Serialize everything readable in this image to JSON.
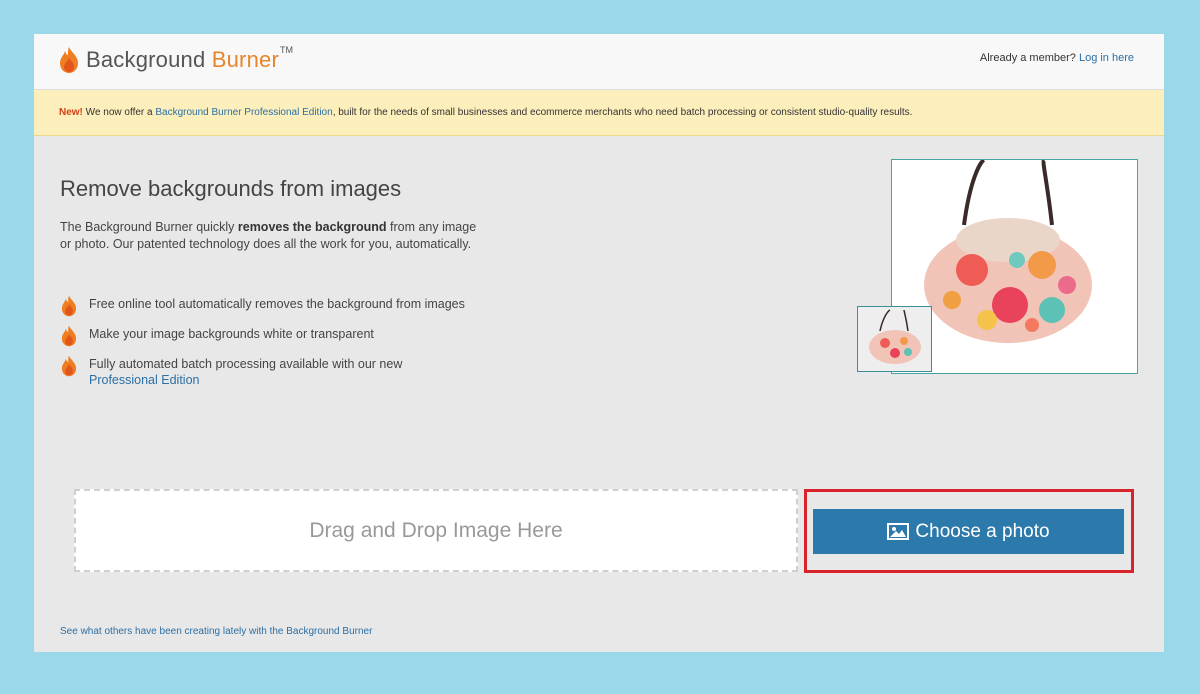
{
  "header": {
    "brand_part1": "Background ",
    "brand_part2": "Burner",
    "trademark": "TM",
    "member_text": "Already a member?",
    "login_link": "Log in here"
  },
  "banner": {
    "new_label": "New!",
    "text_before": " We now offer a ",
    "link": "Background Burner Professional Edition",
    "text_after": ", built for the needs of small businesses and ecommerce merchants who need batch processing or consistent studio-quality results."
  },
  "main": {
    "heading": "Remove backgrounds from images",
    "intro_before": "The Background Burner quickly ",
    "intro_bold": "removes the background",
    "intro_after": " from any image or photo. Our patented technology does all the work for you, automatically.",
    "features": [
      {
        "text": "Free online tool automatically removes the background from images"
      },
      {
        "text": "Make your image backgrounds white or transparent"
      },
      {
        "text": "Fully automated batch processing available with our new ",
        "link": "Professional Edition"
      }
    ]
  },
  "upload": {
    "dropzone_text": "Drag and Drop Image Here",
    "choose_label": "Choose a photo"
  },
  "footer": {
    "link": "See what others have been creating lately with the Background Burner"
  },
  "colors": {
    "accent": "#2c79ab",
    "brand_orange": "#e8852a",
    "highlight_red": "#d8232a",
    "banner_bg": "#fcefbc"
  }
}
